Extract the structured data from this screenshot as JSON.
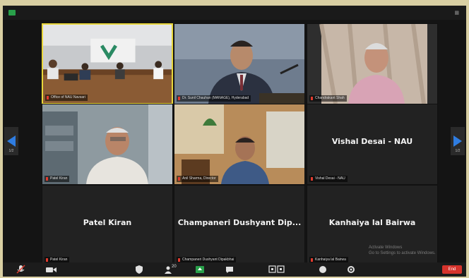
{
  "participants": [
    {
      "label": "Office of NAU Navsari",
      "tile_name": ""
    },
    {
      "label": "Dr. Sunil Chauhan (MANAGE), Hyderabad",
      "tile_name": ""
    },
    {
      "label": "Chandrakant Shah",
      "tile_name": ""
    },
    {
      "label": "Patel Kiran",
      "tile_name": ""
    },
    {
      "label": "Anil Sharma, Director",
      "tile_name": ""
    },
    {
      "label": "Vishal Desai - NAU",
      "tile_name": "Vishal Desai - NAU"
    },
    {
      "label": "Patel Kiran",
      "tile_name": "Patel Kiran"
    },
    {
      "label": "Champaneri Dushyant Dipakbhai",
      "tile_name": "Champaneri Dushyant Dip..."
    },
    {
      "label": "Kanhaiya lal Bairwa",
      "tile_name": "Kanhaiya lal Bairwa"
    }
  ],
  "nav": {
    "prev_page": "1/2",
    "next_page": "1/2"
  },
  "watermark": {
    "line1": "Activate Windows",
    "line2": "Go to Settings to activate Windows."
  },
  "toolbar": {
    "mute": "Mute",
    "video": "Stop Video",
    "security": "Security",
    "participants": "Participants",
    "participants_count": "20",
    "share": "Share Screen",
    "chat": "Chat",
    "record": "Record",
    "breakout": "Breakout Rooms",
    "reactions": "Reactions",
    "more": "More",
    "end": "End"
  },
  "colors": {
    "active_border": "#e8d63a",
    "end_button": "#d6332c",
    "share_green": "#29a04a",
    "mic_red": "#e03b2e"
  }
}
